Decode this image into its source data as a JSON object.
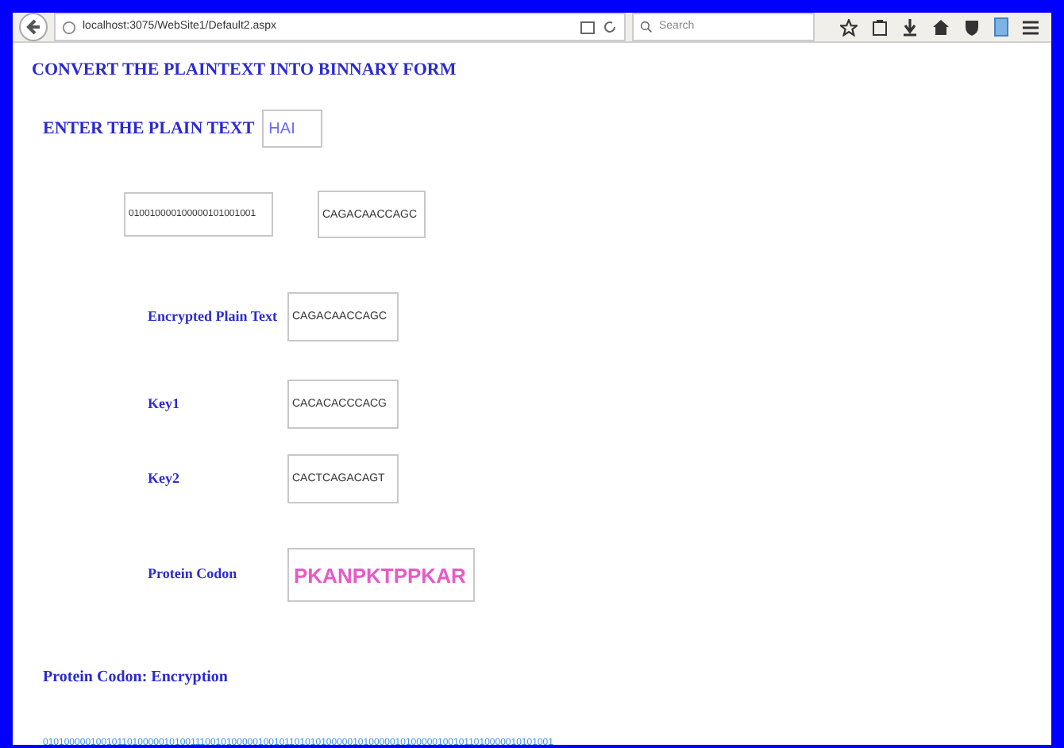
{
  "browser": {
    "url": "localhost:3075/WebSite1/Default2.aspx",
    "search_placeholder": "Search"
  },
  "page": {
    "title": "CONVERT THE PLAINTEXT INTO BINNARY FORM",
    "plain_text": {
      "label": "ENTER THE PLAIN TEXT",
      "value": "HAI"
    },
    "binary_value": "010010000100000101001001",
    "dna_value": "CAGACAACCAGC",
    "rows": [
      {
        "label": "Encrypted Plain Text",
        "value": "CAGACAACCAGC",
        "kind": "text"
      },
      {
        "label": "Key1",
        "value": "CACACACCCACG",
        "kind": "text"
      },
      {
        "label": "Key2",
        "value": "CACTCAGACAGT",
        "kind": "text"
      },
      {
        "label": "Protein Codon",
        "value": "PKANPKTPPKAR",
        "kind": "protein"
      }
    ],
    "encryption_label": "Protein Codon: Encryption",
    "encryption_output": "0101000001001011010000010100111001010000010010110101010000010100000101000001001011010000010101001"
  }
}
